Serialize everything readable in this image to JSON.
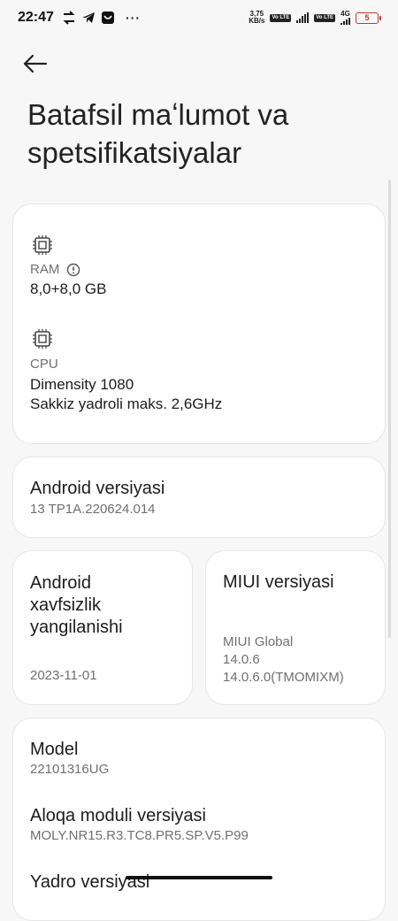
{
  "status_bar": {
    "time": "22:47",
    "net_speed_value": "3,75",
    "net_speed_unit": "KB/s",
    "volte1": "Vo LTE",
    "volte2": "Vo LTE",
    "network_type": "4G",
    "battery": "5",
    "icons": [
      "dual-arrow-icon",
      "telegram-icon",
      "app-icon",
      "more-dots-icon"
    ]
  },
  "header": {
    "title": "Batafsil maʻlumot va spetsifikatsiyalar"
  },
  "hardware": {
    "ram_label": "RAM",
    "ram_value": "8,0+8,0 GB",
    "cpu_label": "CPU",
    "cpu_value": "Dimensity 1080",
    "cpu_detail": "Sakkiz yadroli maks. 2,6GHz"
  },
  "android_version": {
    "label": "Android versiyasi",
    "value": "13 TP1A.220624.014"
  },
  "security_patch": {
    "label": "Android xavfsizlik yangilanishi",
    "value": "2023-11-01"
  },
  "miui_version": {
    "label": "MIUI versiyasi",
    "line1": "MIUI Global",
    "line2": "14.0.6",
    "line3": "14.0.6.0(TMOMIXM)"
  },
  "device_info": {
    "model_label": "Model",
    "model_value": "22101316UG",
    "baseband_label": "Aloqa moduli versiyasi",
    "baseband_value": "MOLY.NR15.R3.TC8.PR5.SP.V5.P99",
    "kernel_label": "Yadro versiyasi"
  },
  "colors": {
    "background": "#f7f7f7",
    "card": "#ffffff",
    "battery_low": "#c0392b"
  }
}
